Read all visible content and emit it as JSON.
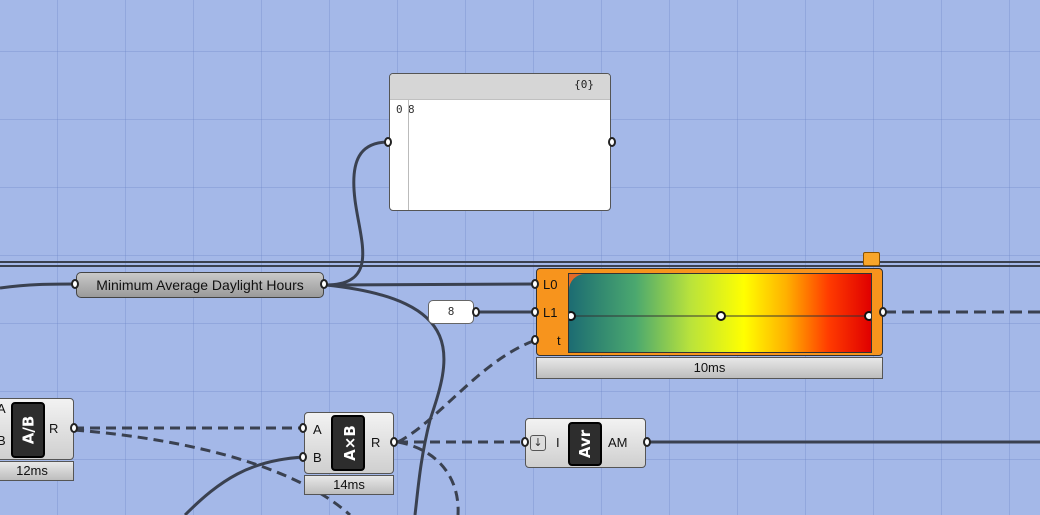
{
  "panel": {
    "header": "{0}",
    "rows": [
      {
        "index": "0",
        "value": "8"
      }
    ]
  },
  "param": {
    "label": "Minimum Average Daylight Hours"
  },
  "slider": {
    "value": "8"
  },
  "gradient": {
    "inputs": [
      "L0",
      "L1",
      "t"
    ],
    "timing": "10ms",
    "colors": [
      "#1c6c72",
      "#4ba86f",
      "#b8e23c",
      "#ffff00",
      "#ffb000",
      "#ff3b00",
      "#e00000"
    ]
  },
  "divide": {
    "symbol": "A/B",
    "inputs": [
      "A",
      "B"
    ],
    "output": "R",
    "timing": "12ms"
  },
  "multiply": {
    "symbol": "A×B",
    "inputs": [
      "A",
      "B"
    ],
    "output": "R",
    "timing": "14ms"
  },
  "average": {
    "symbol": "Avr",
    "input": "I",
    "output": "AM"
  },
  "colors": {
    "canvas": "#a4b8e8",
    "component_orange": "#f7941d",
    "wire": "#3a4150"
  }
}
